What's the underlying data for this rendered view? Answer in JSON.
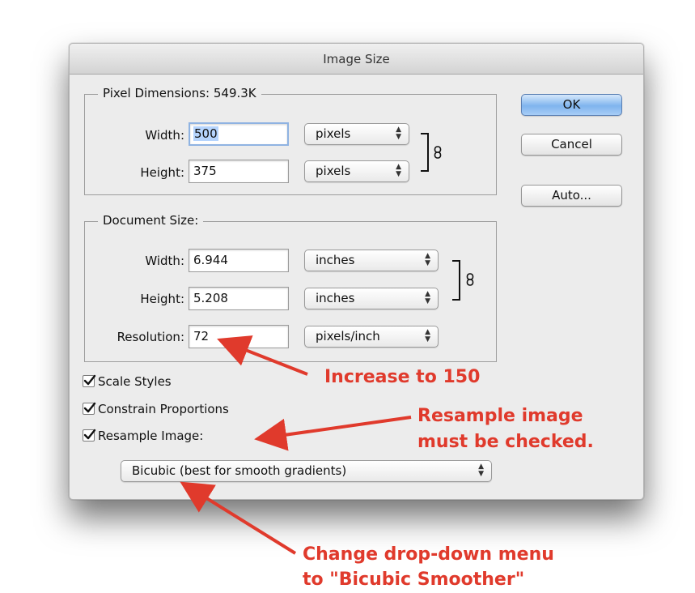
{
  "dialog": {
    "title": "Image Size",
    "buttons": {
      "ok": "OK",
      "cancel": "Cancel",
      "auto": "Auto..."
    }
  },
  "pixel_dimensions": {
    "title": "Pixel Dimensions:",
    "size": "549.3K",
    "width_label": "Width:",
    "width_value": "500",
    "width_unit": "pixels",
    "height_label": "Height:",
    "height_value": "375",
    "height_unit": "pixels"
  },
  "document_size": {
    "title": "Document Size:",
    "width_label": "Width:",
    "width_value": "6.944",
    "width_unit": "inches",
    "height_label": "Height:",
    "height_value": "5.208",
    "height_unit": "inches",
    "resolution_label": "Resolution:",
    "resolution_value": "72",
    "resolution_unit": "pixels/inch"
  },
  "options": {
    "scale_styles": {
      "label": "Scale Styles",
      "checked": true
    },
    "constrain_proportions": {
      "label": "Constrain Proportions",
      "checked": true
    },
    "resample_image": {
      "label": "Resample Image:",
      "checked": true
    },
    "resample_method": "Bicubic (best for smooth gradients)"
  },
  "annotations": {
    "increase": "Increase to 150",
    "resample_line1": "Resample image",
    "resample_line2": "must be checked.",
    "dropdown_line1": "Change drop-down menu",
    "dropdown_line2": "to \"Bicubic Smoother\""
  },
  "colors": {
    "annotation": "#e03a2c",
    "default_button": "#7fb4ee",
    "dialog_bg": "#ececec"
  }
}
